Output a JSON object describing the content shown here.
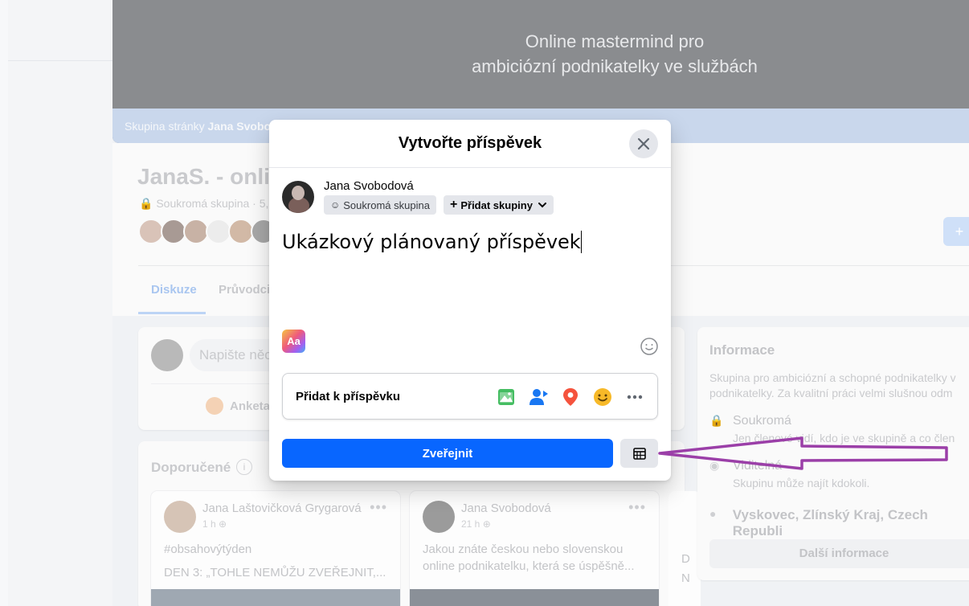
{
  "cover": {
    "title_line1": "Online mastermind pro",
    "title_line2": "ambiciózní podnikatelky ve službách",
    "strip_prefix": "Skupina stránky ",
    "strip_name": "Jana Svobo"
  },
  "group": {
    "name": "JanaS. - onli",
    "meta": "Soukromá skupina · 5,",
    "join_label": "+"
  },
  "tabs": [
    {
      "label": "Diskuze"
    },
    {
      "label": "Průvodci"
    }
  ],
  "composer": {
    "placeholder": "Napište něco",
    "poll_label": "Anketa"
  },
  "recommended": {
    "title": "Doporučené",
    "info": "i",
    "posts": [
      {
        "author": "Jana Laštovičková Grygarová",
        "time": "1 h",
        "line1": "#obsahovýtýden",
        "line2": "DEN 3: „TOHLE NEMŮŽU ZVEŘEJNIT,..."
      },
      {
        "author": "Jana Svobodová",
        "time": "21 h",
        "line1": "Jakou znáte českou nebo slovenskou",
        "line2": "online podnikatelku, která se úspěšně..."
      }
    ],
    "post3_letters": [
      "D",
      "N"
    ]
  },
  "info": {
    "title": "Informace",
    "description": "Skupina pro ambiciózní a schopné podnikatelky v podnikatelky. Za kvalitní práci velmi slušnou odm",
    "private_title": "Soukromá",
    "private_desc": "Jen členové vidí, kdo je ve skupině a co člen",
    "visible_title": "Viditelná",
    "visible_desc": "Skupinu může najít kdokoli.",
    "location": "Vyskovec, Zlínský Kraj, Czech Republi",
    "more_button": "Další informace"
  },
  "modal": {
    "title": "Vytvořte příspěvek",
    "author": "Jana Svobodová",
    "privacy_chip": "Soukromá skupina",
    "add_groups_chip": "Přidat skupiny",
    "post_text": "Ukázkový plánovaný příspěvek",
    "aa_label": "Aa",
    "add_to_post": "Přidat k příspěvku",
    "publish_button": "Zveřejnit",
    "icons": [
      "photo-video-icon",
      "tag-people-icon",
      "location-pin-icon",
      "feeling-emoji-icon",
      "more-icon"
    ]
  },
  "colors": {
    "accent_blue": "#0866ff",
    "annotation_arrow": "#9b3fa8"
  }
}
